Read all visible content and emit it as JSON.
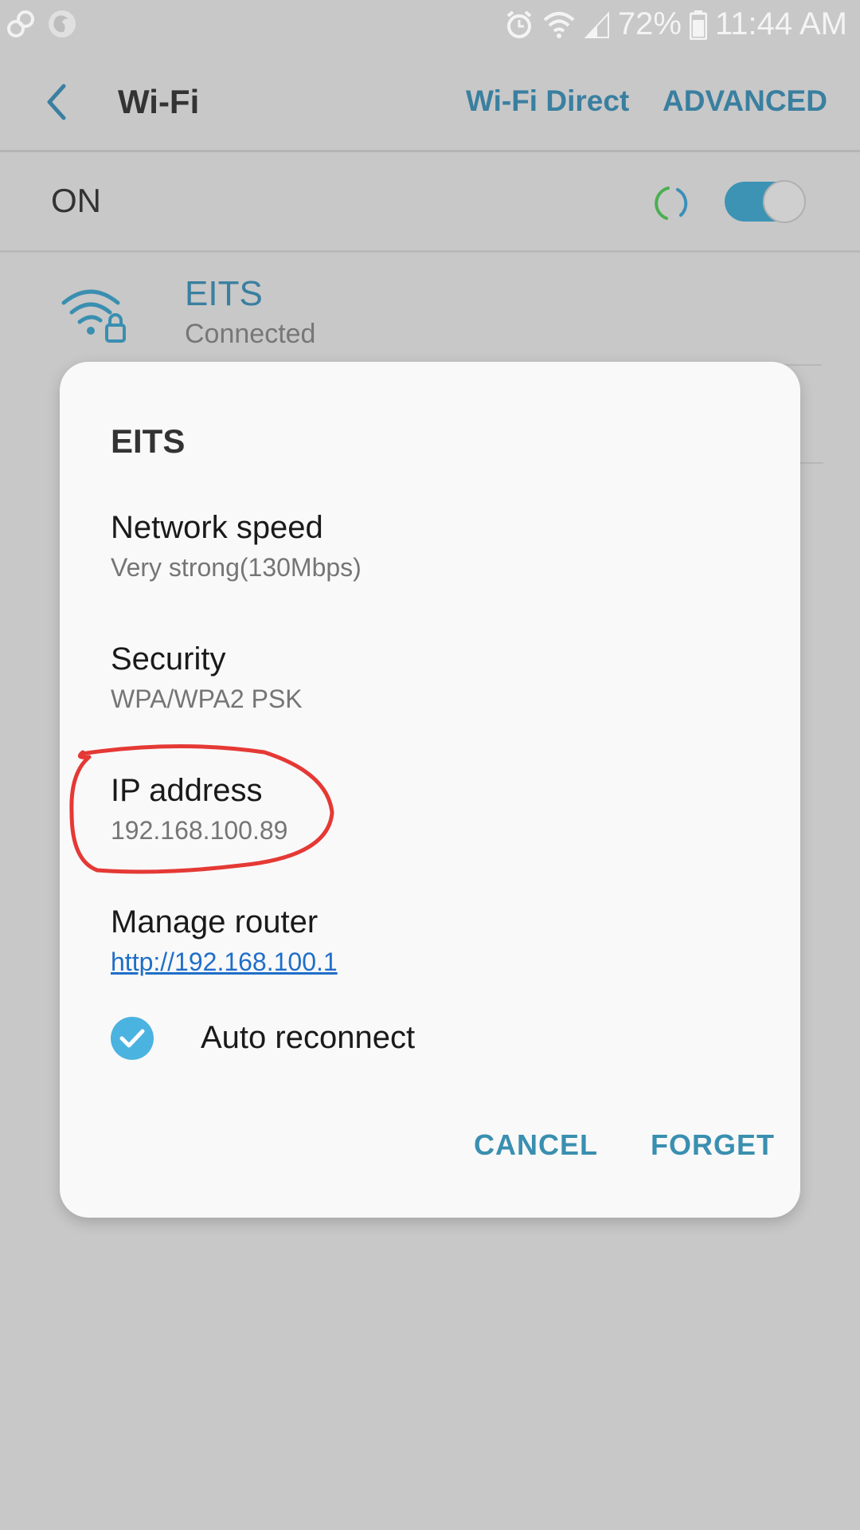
{
  "status_bar": {
    "left_icons": [
      "link-icon",
      "firefox-icon"
    ],
    "right_icons": [
      "alarm-icon",
      "wifi-icon",
      "signal-icon",
      "battery-icon"
    ],
    "battery": "72%",
    "time": "11:44 AM"
  },
  "app_bar": {
    "title": "Wi-Fi",
    "wifi_direct": "Wi-Fi Direct",
    "advanced": "ADVANCED"
  },
  "wifi_toggle": {
    "label": "ON",
    "state": "on"
  },
  "network": {
    "name": "EITS",
    "status": "Connected",
    "icon": "wifi-lock-icon"
  },
  "dialog": {
    "title": "EITS",
    "items": [
      {
        "label": "Network speed",
        "value": "Very strong(130Mbps)"
      },
      {
        "label": "Security",
        "value": "WPA/WPA2 PSK"
      },
      {
        "label": "IP address",
        "value": "192.168.100.89"
      },
      {
        "label": "Manage router",
        "value": "http://192.168.100.1"
      }
    ],
    "auto_reconnect": {
      "label": "Auto reconnect",
      "checked": true
    },
    "cancel": "CANCEL",
    "forget": "FORGET"
  },
  "colors": {
    "accent": "#3a7fa0",
    "toggle_on": "#3d93b4",
    "checkbox": "#4bb3e0",
    "link": "#1f6fc8",
    "annotation": "#e53935"
  }
}
